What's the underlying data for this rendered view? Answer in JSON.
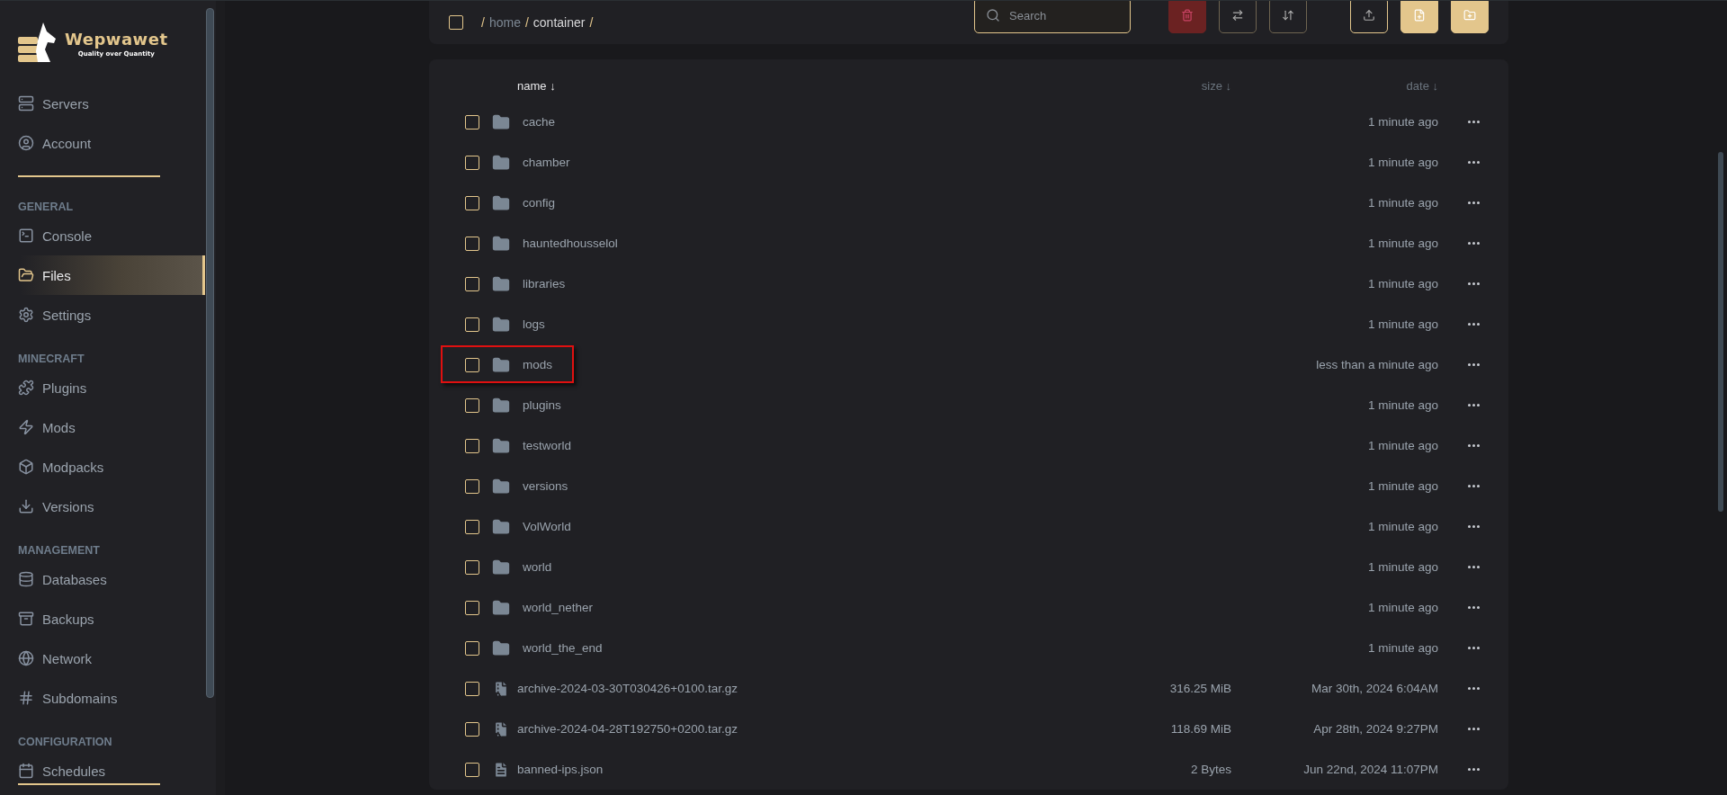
{
  "sidebar": {
    "logo": {
      "title": "Wepwawet",
      "tagline": "Quality over Quantity"
    },
    "sections": [
      {
        "items": [
          {
            "label": "Servers",
            "selected": false
          },
          {
            "label": "Account",
            "selected": false
          }
        ]
      },
      {
        "heading": "GENERAL",
        "items": [
          {
            "label": "Console",
            "selected": false
          },
          {
            "label": "Files",
            "selected": true
          },
          {
            "label": "Settings",
            "selected": false
          }
        ]
      },
      {
        "heading": "MINECRAFT",
        "items": [
          {
            "label": "Plugins",
            "selected": false
          },
          {
            "label": "Mods",
            "selected": false
          },
          {
            "label": "Modpacks",
            "selected": false
          },
          {
            "label": "Versions",
            "selected": false
          }
        ]
      },
      {
        "heading": "MANAGEMENT",
        "items": [
          {
            "label": "Databases",
            "selected": false
          },
          {
            "label": "Backups",
            "selected": false
          },
          {
            "label": "Network",
            "selected": false
          },
          {
            "label": "Subdomains",
            "selected": false
          }
        ]
      },
      {
        "heading": "CONFIGURATION",
        "items": [
          {
            "label": "Schedules",
            "selected": false
          }
        ]
      }
    ]
  },
  "toolbar": {
    "select_all": {
      "checked": false
    },
    "breadcrumb": [
      {
        "kind": "separator",
        "text": "/"
      },
      {
        "kind": "link",
        "text": "home"
      },
      {
        "kind": "separator",
        "text": "/"
      },
      {
        "kind": "current",
        "text": "container"
      },
      {
        "kind": "separator",
        "text": "/"
      }
    ],
    "search": {
      "placeholder": "Search"
    }
  },
  "table": {
    "columns": [
      {
        "label": "name",
        "arrow": "↓",
        "selected": true
      },
      {
        "label": "size",
        "arrow": "↓",
        "selected": false
      },
      {
        "label": "date",
        "arrow": "↓",
        "selected": false
      }
    ],
    "rows": [
      {
        "kind": "folder",
        "name": "cache",
        "date": "1 minute ago",
        "checked": false,
        "highlighted": false
      },
      {
        "kind": "folder",
        "name": "chamber",
        "date": "1 minute ago",
        "checked": false,
        "highlighted": false
      },
      {
        "kind": "folder",
        "name": "config",
        "date": "1 minute ago",
        "checked": false,
        "highlighted": false
      },
      {
        "kind": "folder",
        "name": "hauntedhousselol",
        "date": "1 minute ago",
        "checked": false,
        "highlighted": false
      },
      {
        "kind": "folder",
        "name": "libraries",
        "date": "1 minute ago",
        "checked": false,
        "highlighted": false
      },
      {
        "kind": "folder",
        "name": "logs",
        "date": "1 minute ago",
        "checked": false,
        "highlighted": false
      },
      {
        "kind": "folder",
        "name": "mods",
        "date": "less than a minute ago",
        "checked": false,
        "highlighted": true
      },
      {
        "kind": "folder",
        "name": "plugins",
        "date": "1 minute ago",
        "checked": false,
        "highlighted": false
      },
      {
        "kind": "folder",
        "name": "testworld",
        "date": "1 minute ago",
        "checked": false,
        "highlighted": false
      },
      {
        "kind": "folder",
        "name": "versions",
        "date": "1 minute ago",
        "checked": false,
        "highlighted": false
      },
      {
        "kind": "folder",
        "name": "VolWorld",
        "date": "1 minute ago",
        "checked": false,
        "highlighted": false
      },
      {
        "kind": "folder",
        "name": "world",
        "date": "1 minute ago",
        "checked": false,
        "highlighted": false
      },
      {
        "kind": "folder",
        "name": "world_nether",
        "date": "1 minute ago",
        "checked": false,
        "highlighted": false
      },
      {
        "kind": "folder",
        "name": "world_the_end",
        "date": "1 minute ago",
        "checked": false,
        "highlighted": false
      },
      {
        "kind": "archive",
        "name": "archive-2024-03-30T030426+0100.tar.gz",
        "size": "316.25 MiB",
        "date": "Mar 30th, 2024 6:04AM",
        "checked": false,
        "highlighted": false
      },
      {
        "kind": "archive",
        "name": "archive-2024-04-28T192750+0200.tar.gz",
        "size": "118.69 MiB",
        "date": "Apr 28th, 2024 9:27PM",
        "checked": false,
        "highlighted": false
      },
      {
        "kind": "file",
        "name": "banned-ips.json",
        "size": "2 Bytes",
        "date": "Jun 22nd, 2024 11:07PM",
        "checked": false,
        "highlighted": false
      }
    ]
  }
}
